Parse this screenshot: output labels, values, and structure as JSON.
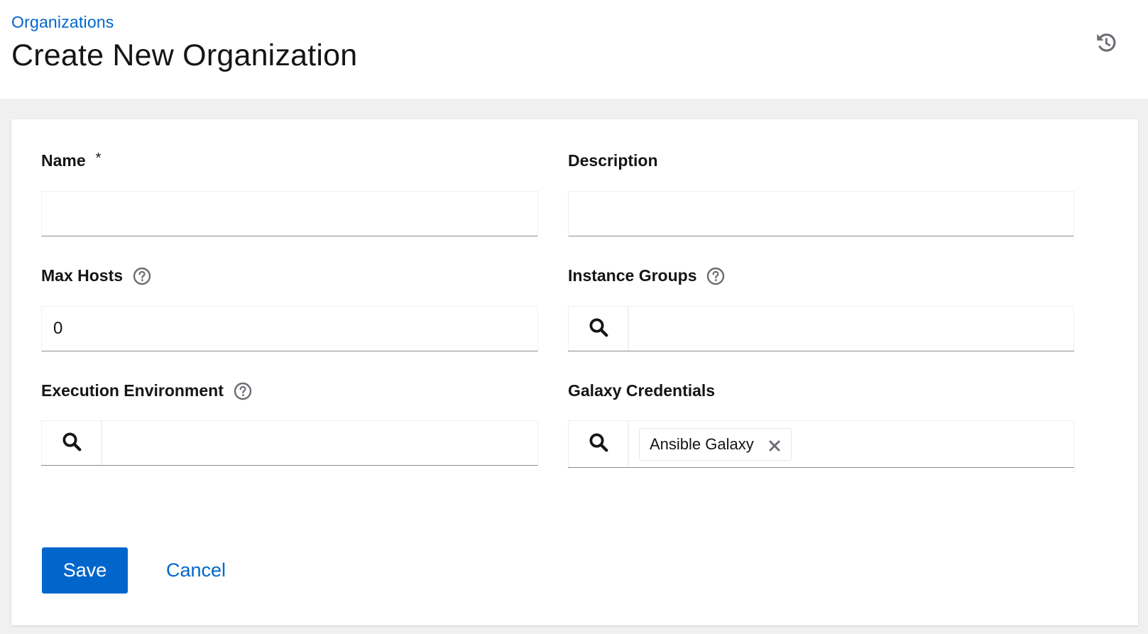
{
  "header": {
    "breadcrumb": "Organizations",
    "title": "Create New Organization",
    "history_icon": "history-icon"
  },
  "form": {
    "name": {
      "label": "Name",
      "required_marker": "*",
      "value": ""
    },
    "description": {
      "label": "Description",
      "value": ""
    },
    "max_hosts": {
      "label": "Max Hosts",
      "value": "0",
      "help_icon": "help-icon"
    },
    "instance_groups": {
      "label": "Instance Groups",
      "help_icon": "help-icon",
      "search_icon": "search-icon"
    },
    "execution_environment": {
      "label": "Execution Environment",
      "help_icon": "help-icon",
      "search_icon": "search-icon"
    },
    "galaxy_credentials": {
      "label": "Galaxy Credentials",
      "search_icon": "search-icon",
      "chips": [
        "Ansible Galaxy"
      ]
    }
  },
  "actions": {
    "save_label": "Save",
    "cancel_label": "Cancel"
  },
  "colors": {
    "accent": "#0066cc",
    "text": "#151515",
    "page_bg": "#f0f0f0",
    "card_bg": "#ffffff",
    "icon_gray": "#6a6e73"
  }
}
